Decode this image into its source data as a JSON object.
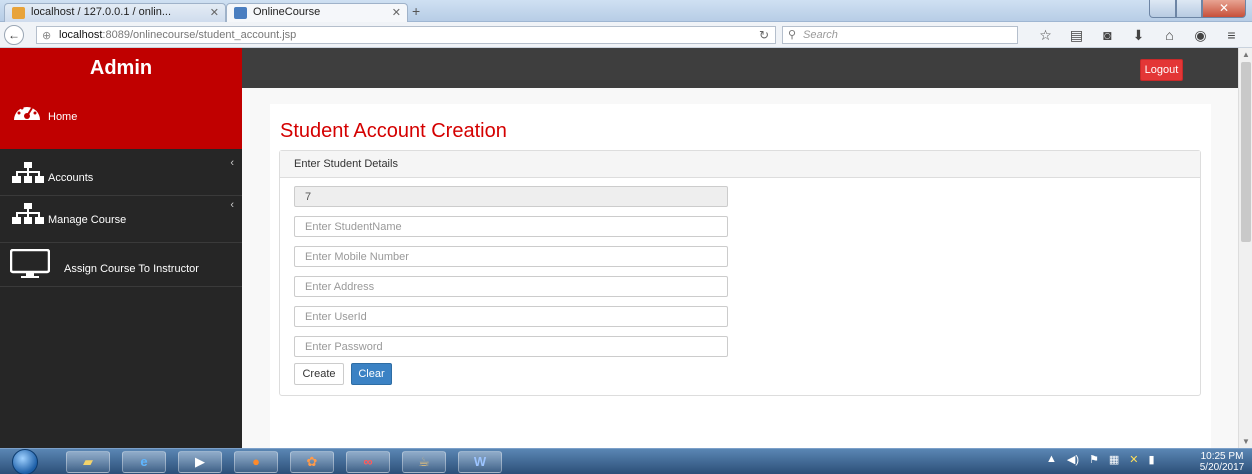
{
  "browser": {
    "tabs": [
      {
        "title": "localhost / 127.0.0.1 / onlin...",
        "icon": "phpmyadmin-favicon"
      },
      {
        "title": "OnlineCourse",
        "icon": "page-favicon"
      }
    ],
    "url_host": "localhost",
    "url_rest": ":8089/onlinecourse/student_account.jsp",
    "search_placeholder": "Search"
  },
  "sidebar": {
    "brand": "Admin",
    "items": [
      {
        "label": "Home",
        "icon": "dashboard-icon"
      },
      {
        "label": "Accounts",
        "icon": "sitemap-icon"
      },
      {
        "label": "Manage Course",
        "icon": "sitemap-icon"
      },
      {
        "label": "Assign Course To Instructor",
        "icon": "monitor-icon"
      }
    ]
  },
  "topbar": {
    "logout_label": "Logout"
  },
  "main": {
    "title": "Student Account Creation",
    "panel_title": "Enter Student Details",
    "id_value": "7",
    "fields": [
      {
        "placeholder": "Enter StudentName"
      },
      {
        "placeholder": "Enter Mobile Number"
      },
      {
        "placeholder": "Enter Address"
      },
      {
        "placeholder": "Enter UserId"
      },
      {
        "placeholder": "Enter Password"
      }
    ],
    "create_label": "Create",
    "clear_label": "Clear"
  },
  "taskbar": {
    "time": "10:25 PM",
    "date": "5/20/2017"
  },
  "colors": {
    "accent_red": "#c00000",
    "title_red": "#d40000",
    "sidebar_dark": "#262626",
    "topbar_dark": "#3e3e3e",
    "logout_red": "#e33636",
    "clear_blue": "#3b82c4"
  }
}
